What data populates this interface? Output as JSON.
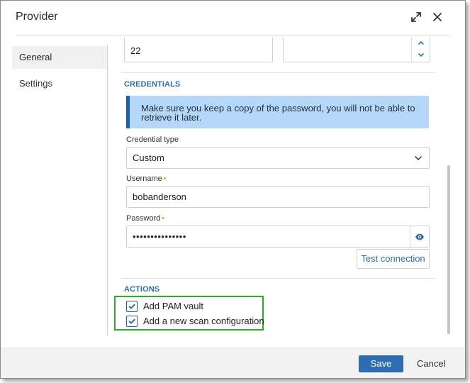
{
  "dialog": {
    "title": "Provider"
  },
  "nav": {
    "items": [
      {
        "label": "General"
      },
      {
        "label": "Settings"
      }
    ]
  },
  "form": {
    "port_value": "22",
    "credentials_section": "CREDENTIALS",
    "info_message": "Make sure you keep a copy of the password, you will not be able to retrieve it later.",
    "credential_type_label": "Credential type",
    "credential_type_value": "Custom",
    "username_label": "Username",
    "username_value": "bobanderson",
    "password_label": "Password",
    "password_value": "•••••••••••••••",
    "required_marker": "•",
    "test_connection": "Test connection",
    "actions_section": "ACTIONS",
    "actions": [
      {
        "label": "Add PAM vault",
        "checked": true
      },
      {
        "label": "Add a new scan configuration",
        "checked": true
      }
    ]
  },
  "footer": {
    "save": "Save",
    "cancel": "Cancel"
  },
  "icons": {
    "expand": "expand-icon",
    "close": "close-icon",
    "chevron_up": "chevron-up-icon",
    "chevron_down": "chevron-down-icon",
    "eye": "eye-icon",
    "check": "check-icon"
  },
  "colors": {
    "accent": "#2e6db4",
    "info_bg": "#b5d8f8",
    "highlight": "#20b520",
    "required": "#f0a020"
  }
}
